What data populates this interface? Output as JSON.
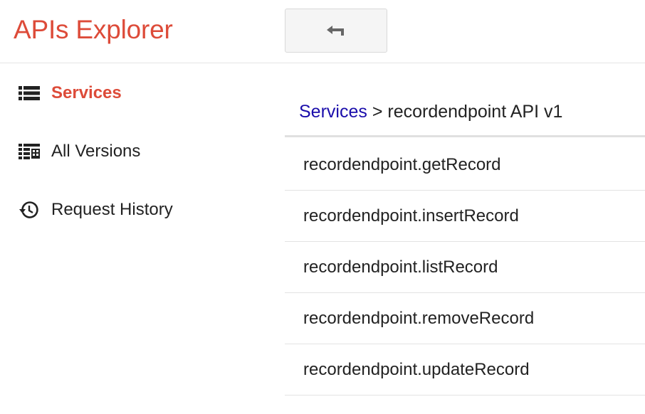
{
  "header": {
    "title": "APIs Explorer",
    "back_icon": "back-arrow-icon"
  },
  "sidebar": {
    "items": [
      {
        "label": "Services",
        "icon": "list-icon",
        "active": true
      },
      {
        "label": "All Versions",
        "icon": "versions-grid-icon",
        "active": false
      },
      {
        "label": "Request History",
        "icon": "history-icon",
        "active": false
      }
    ]
  },
  "breadcrumb": {
    "link": "Services",
    "separator": ">",
    "current": "recordendpoint API v1"
  },
  "methods": [
    "recordendpoint.getRecord",
    "recordendpoint.insertRecord",
    "recordendpoint.listRecord",
    "recordendpoint.removeRecord",
    "recordendpoint.updateRecord"
  ],
  "colors": {
    "accent": "#dd4b39",
    "link": "#1a0dab",
    "text": "#222222",
    "divider": "#e3e3e3"
  }
}
